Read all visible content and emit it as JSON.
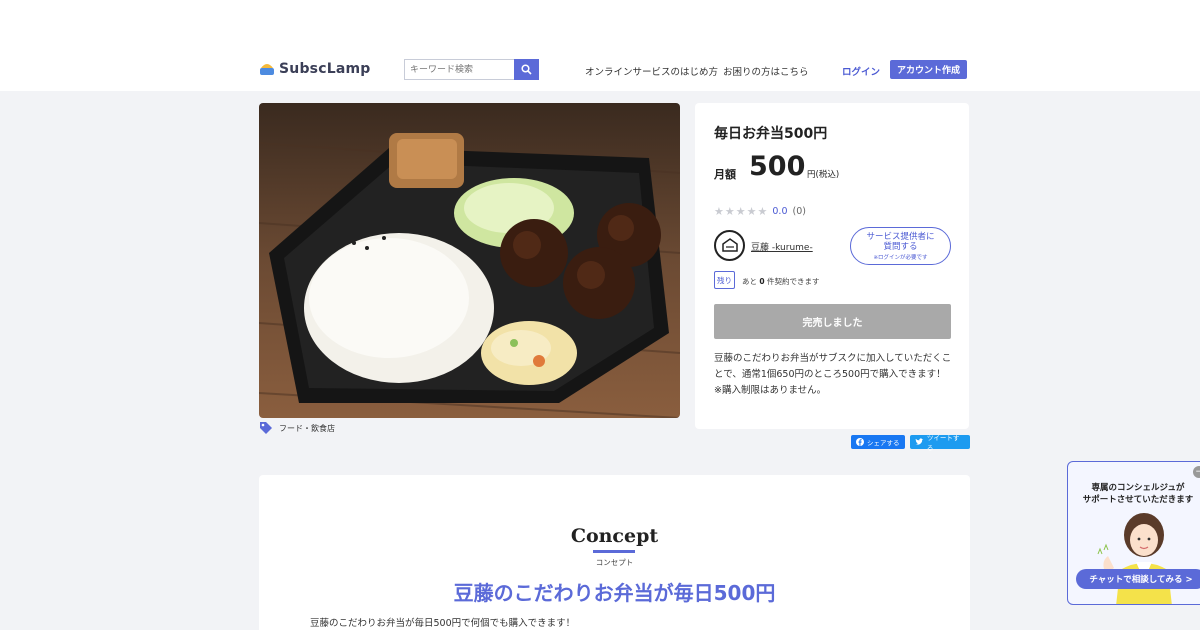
{
  "header": {
    "logo_text": "SubscLamp",
    "search_placeholder": "キーワード検索",
    "nav": [
      "オンラインサービスのはじめ方",
      "お困りの方はこちら"
    ],
    "login": "ログイン",
    "signup": "アカウント作成"
  },
  "product": {
    "category": "フード・飲食店",
    "title": "毎日お弁当500円",
    "monthly_label": "月額",
    "price": "500",
    "price_unit": "円(税込)",
    "rating": {
      "value": "0.0",
      "count": "(0)",
      "stars": 0
    },
    "provider": "豆藤 -kurume-",
    "ask_button": {
      "line1": "サービス提供者に",
      "line2": "質問する",
      "note": "※ログインが必要です"
    },
    "stock_badge": "残り",
    "stock_prefix": "あと",
    "stock_count": "0",
    "stock_suffix": "件契約できます",
    "soldout": "完売しました",
    "description": "豆藤のこだわりお弁当がサブスクに加入していただくことで、通常1個650円のところ500円で購入できます！ ※購入制限はありません。"
  },
  "share": {
    "facebook": "シェアする",
    "twitter": "ツイートする"
  },
  "concept": {
    "title": "Concept",
    "subtitle": "コンセプト",
    "headline": "豆藤のこだわりお弁当が毎日500円",
    "body": "豆藤のこだわりお弁当が毎日500円で何個でも購入できます！"
  },
  "concierge": {
    "line1": "専属のコンシェルジュが",
    "line2": "サポートさせていただきます",
    "button": "チャットで相談してみる >",
    "close": "−"
  },
  "colors": {
    "accent": "#5b6ad8",
    "soldout": "#a9a9a9",
    "background": "#f2f3f6"
  }
}
